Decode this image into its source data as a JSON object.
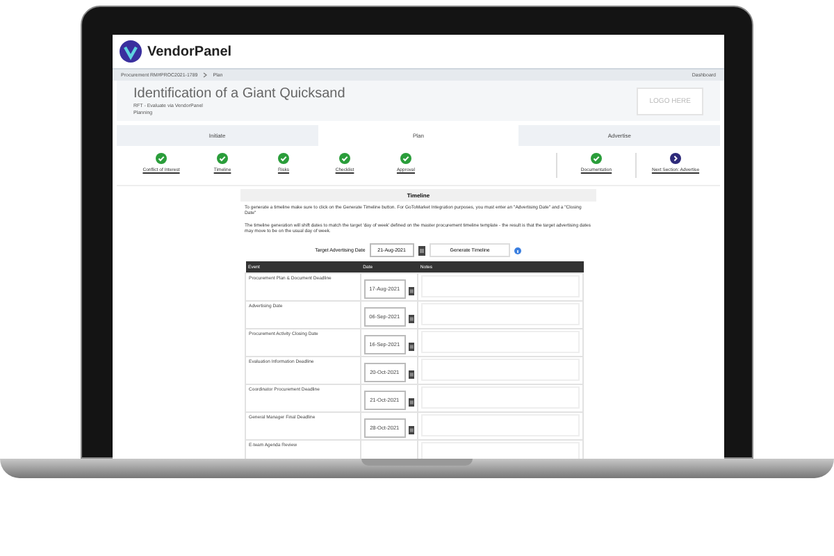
{
  "brand": {
    "name": "VendorPanel"
  },
  "breadcrumb": {
    "items": [
      "Procurement RM#PROC2021-1789",
      "Plan"
    ],
    "right_link": "Dashboard"
  },
  "header": {
    "title": "Identification of a Giant Quicksand",
    "subtitle": "RFT - Evaluate via VendorPanel",
    "status": "Planning",
    "logo_text": "LOGO HERE"
  },
  "tabs": [
    {
      "label": "Initiate",
      "selected": false
    },
    {
      "label": "Plan",
      "selected": true
    },
    {
      "label": "Advertise",
      "selected": false
    }
  ],
  "steps": [
    {
      "label": "Conflict of Interest",
      "kind": "done"
    },
    {
      "label": "Timeline",
      "kind": "done"
    },
    {
      "label": "Risks",
      "kind": "done"
    },
    {
      "label": "Checklist",
      "kind": "done"
    },
    {
      "label": "Approval",
      "kind": "done"
    }
  ],
  "side_steps": [
    {
      "label": "Documentation",
      "kind": "done"
    },
    {
      "label": "Next Section: Advertise",
      "kind": "next"
    }
  ],
  "timeline": {
    "title": "Timeline",
    "paragraphs": [
      "To generate a timeline make sure to click on the Generate Timeline button. For GoToMarket Integration purposes, you must enter an \"Advertising Date\" and a \"Closing Date\"",
      "The timeline generation will shift dates to match the target 'day of week' defined on the master procurement timeline template - the result is that the target advertising dates may move to be on the usual day of week."
    ],
    "target_label": "Target Advertising Date",
    "target_value": "21-Aug-2021",
    "generate_button": "Generate Timeline",
    "columns": [
      "Event",
      "Date",
      "Notes"
    ],
    "rows": [
      {
        "event": "Procurement Plan & Document Deadline",
        "date": "17-Aug-2021"
      },
      {
        "event": "Advertising Date",
        "date": "06-Sep-2021"
      },
      {
        "event": "Procurement Activity Closing Date",
        "date": "16-Sep-2021"
      },
      {
        "event": "Evaluation Information Deadline",
        "date": "20-Oct-2021"
      },
      {
        "event": "Coordinator Procurement Deadline",
        "date": "21-Oct-2021"
      },
      {
        "event": "General Manager Final Deadline",
        "date": "28-Oct-2021"
      },
      {
        "event": "E-team Agenda Review"
      }
    ]
  }
}
